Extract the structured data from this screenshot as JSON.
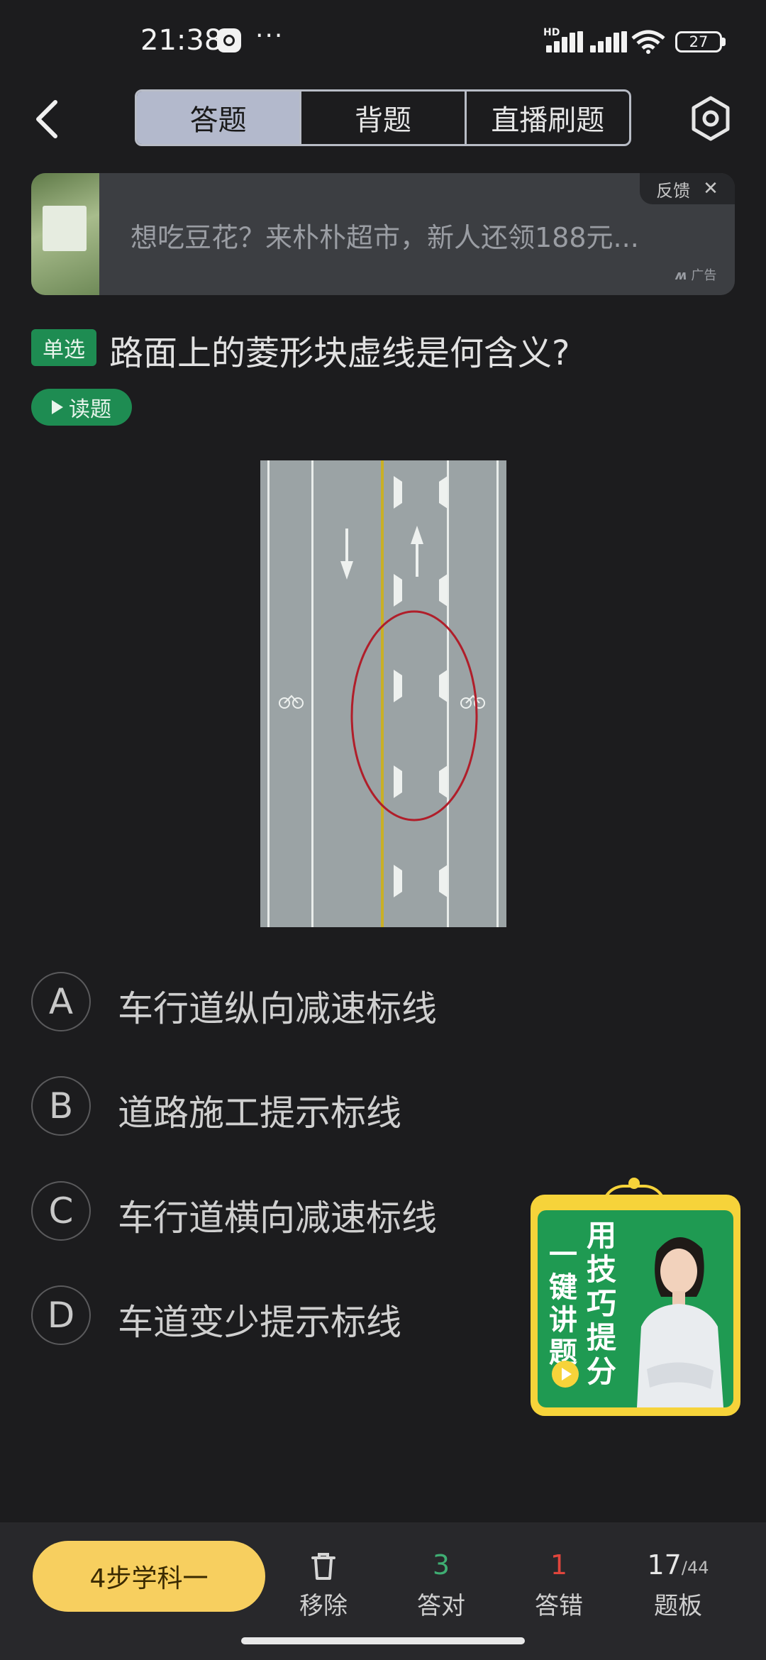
{
  "status_bar": {
    "time": "21:38",
    "more": "···",
    "network": "HD",
    "battery": "27"
  },
  "header": {
    "tabs": [
      "答题",
      "背题",
      "直播刷题"
    ],
    "active_tab": 0
  },
  "ad": {
    "text": "想吃豆花？来朴朴超市，新人还领188元...",
    "feedback": "反馈",
    "close": "✕",
    "tag": "广告"
  },
  "question": {
    "type": "单选",
    "text": "路面上的菱形块虚线是何含义?",
    "read_label": "读题"
  },
  "options": [
    {
      "letter": "A",
      "text": "车行道纵向减速标线"
    },
    {
      "letter": "B",
      "text": "道路施工提示标线"
    },
    {
      "letter": "C",
      "text": "车行道横向减速标线"
    },
    {
      "letter": "D",
      "text": "车道变少提示标线"
    }
  ],
  "promo": {
    "left_text": "一键讲题",
    "right_text": "用技巧提分"
  },
  "bottom": {
    "cta": "4步学科一",
    "remove_label": "移除",
    "correct_count": "3",
    "correct_label": "答对",
    "wrong_count": "1",
    "wrong_label": "答错",
    "board_current": "17",
    "board_total": "/44",
    "board_label": "题板"
  },
  "colors": {
    "background": "#1c1c1e",
    "accent_green": "#1e8c52",
    "cta_yellow": "#f7cf5f",
    "correct_green": "#3fae73",
    "wrong_red": "#e0453c"
  }
}
